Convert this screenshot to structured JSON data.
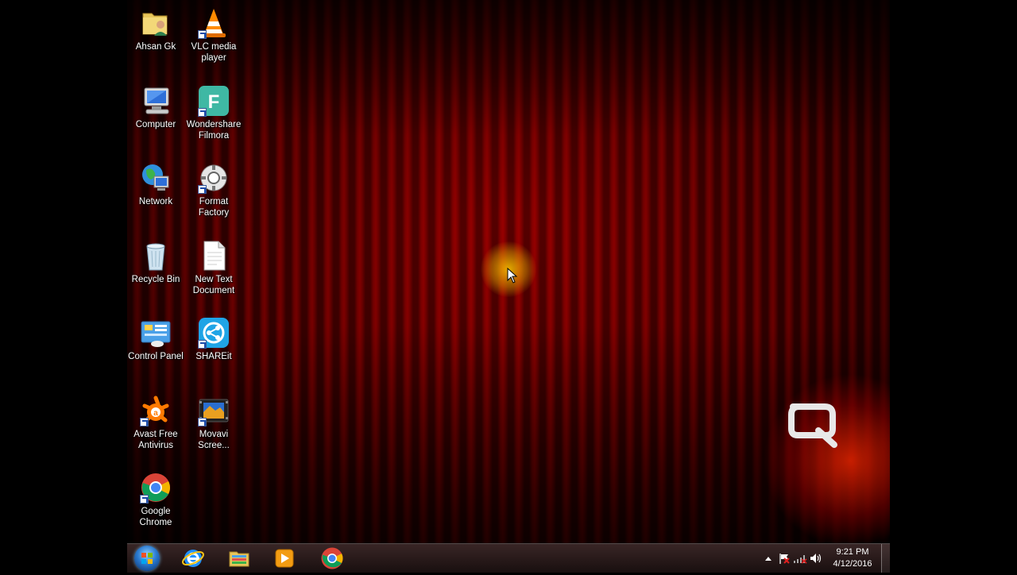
{
  "desktop_icons": [
    {
      "name": "ahsan-gk-folder",
      "label": "Ahsan Gk",
      "icon": "user-folder-icon"
    },
    {
      "name": "vlc-media-player",
      "label": "VLC media player",
      "icon": "vlc-cone-icon"
    },
    {
      "name": "computer",
      "label": "Computer",
      "icon": "computer-icon"
    },
    {
      "name": "wondershare-filmora",
      "label": "Wondershare Filmora",
      "icon": "filmora-icon"
    },
    {
      "name": "network",
      "label": "Network",
      "icon": "network-globe-icon"
    },
    {
      "name": "format-factory",
      "label": "Format Factory",
      "icon": "format-factory-icon"
    },
    {
      "name": "recycle-bin",
      "label": "Recycle Bin",
      "icon": "recycle-bin-icon"
    },
    {
      "name": "new-text-document",
      "label": "New Text Document",
      "icon": "text-document-icon"
    },
    {
      "name": "control-panel",
      "label": "Control Panel",
      "icon": "control-panel-icon"
    },
    {
      "name": "shareit",
      "label": "SHAREit",
      "icon": "shareit-icon"
    },
    {
      "name": "avast-free-antivirus",
      "label": "Avast Free Antivirus",
      "icon": "avast-icon"
    },
    {
      "name": "movavi-screen",
      "label": "Movavi Scree...",
      "icon": "movavi-icon"
    },
    {
      "name": "google-chrome",
      "label": "Google Chrome",
      "icon": "chrome-icon"
    }
  ],
  "taskbar": {
    "start": {
      "icon": "windows-start-orb-icon"
    },
    "pinned": [
      {
        "name": "internet-explorer",
        "icon": "internet-explorer-icon"
      },
      {
        "name": "windows-explorer",
        "icon": "folder-library-icon"
      },
      {
        "name": "media-player",
        "icon": "media-player-icon"
      },
      {
        "name": "chrome",
        "icon": "chrome-icon"
      }
    ],
    "tray": {
      "icons": [
        "show-hidden-icons-arrow-icon",
        "action-center-flag-icon",
        "network-signal-icon",
        "volume-icon"
      ],
      "time": "9:21 PM",
      "date": "4/12/2016"
    }
  },
  "wallpaper": {
    "brand_logo": "compaq-q-logo",
    "base_color": "#8e0000",
    "glow_color": "#ff2800"
  }
}
